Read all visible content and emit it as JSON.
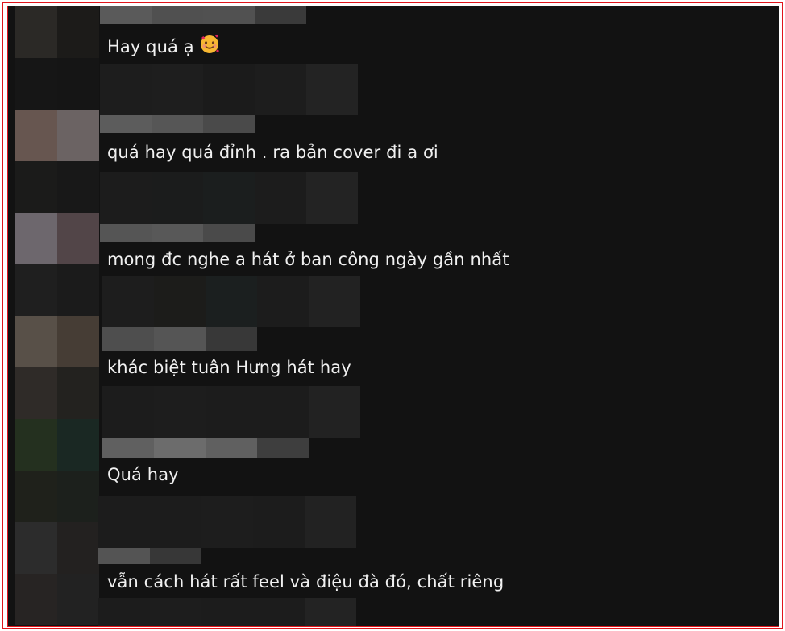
{
  "comments": [
    {
      "text": "Hay quá ạ",
      "emoji": "smiling-face-with-hearts-emoji"
    },
    {
      "text": "quá hay quá đỉnh . ra bản cover đi a ơi"
    },
    {
      "text": "mong đc nghe a hát ở ban công ngày gần nhất"
    },
    {
      "text": "khác biệt tuân Hưng hát hay"
    },
    {
      "text": "Quá hay"
    },
    {
      "text": "vẫn cách hát rất feel và điệu đà đó, chất riêng"
    }
  ],
  "colors": {
    "background": "#121212",
    "frame_border": "#e0141b",
    "comment_text": "#f1f1f1"
  }
}
